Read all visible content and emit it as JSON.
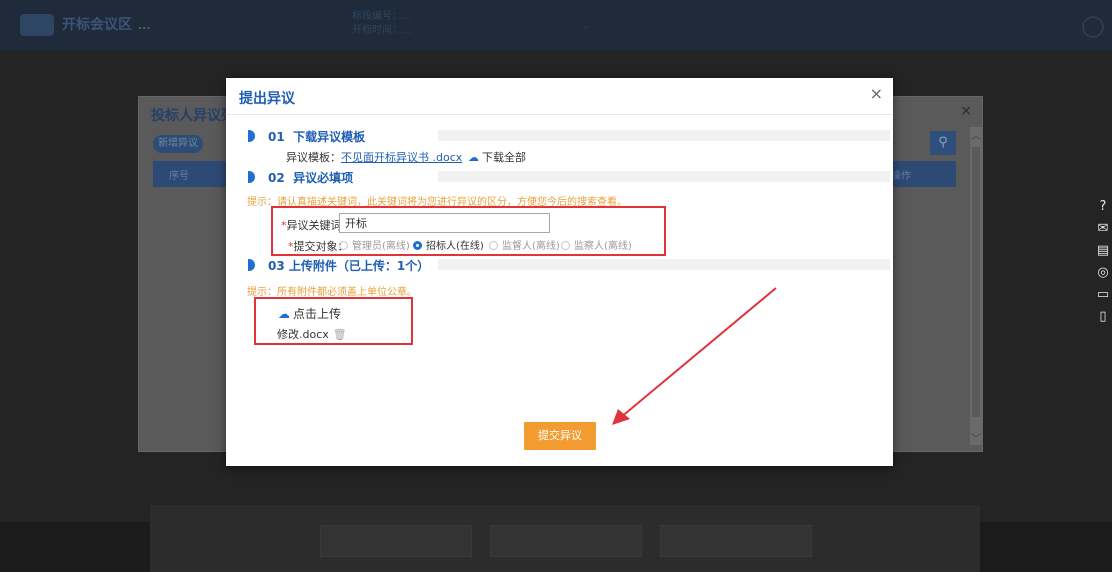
{
  "background": {
    "logo_text": "开标会议区",
    "logo_sub": "...",
    "info_lines": [
      "标段编号：...",
      "开标时间：..."
    ],
    "info_right": "...",
    "list_dialog": {
      "title": "投标人异议列表",
      "add_button": "新增异议",
      "header_no": "序号",
      "header_op": "操作"
    }
  },
  "side_icons": [
    "help-icon",
    "mail-icon",
    "clipboard-icon",
    "chat-icon",
    "message-icon",
    "book-icon"
  ],
  "modal": {
    "title": "提出异议",
    "close": "×",
    "section1": {
      "number": "01",
      "title": "下载异议模板",
      "template_label": "异议模板：",
      "template_link": "不见面开标异议书 .docx",
      "download_all": "下载全部"
    },
    "section2": {
      "number": "02",
      "title": "异议必填项",
      "hint": "提示：请认真描述关键词，此关键词将为您进行异议的区分，方便您今后的搜索查看。",
      "keyword_label": "异议关键词：",
      "keyword_value": "开标",
      "target_label": "提交对象：",
      "radio_options": [
        {
          "label": "管理员(离线)",
          "checked": false
        },
        {
          "label": "招标人(在线)",
          "checked": true
        },
        {
          "label": "监督人(离线)",
          "checked": false
        },
        {
          "label": "监察人(离线)",
          "checked": false
        }
      ]
    },
    "section3": {
      "number": "03",
      "title": "上传附件（已上传：1个）",
      "hint": "提示：所有附件都必须盖上单位公章。",
      "upload_label": "点击上传",
      "file_name": "修改.docx"
    },
    "submit_label": "提交异议"
  },
  "colors": {
    "primary": "#1f5fb3",
    "accent": "#f39c32",
    "annotation": "#e0343a",
    "hint": "#e6a23c"
  }
}
